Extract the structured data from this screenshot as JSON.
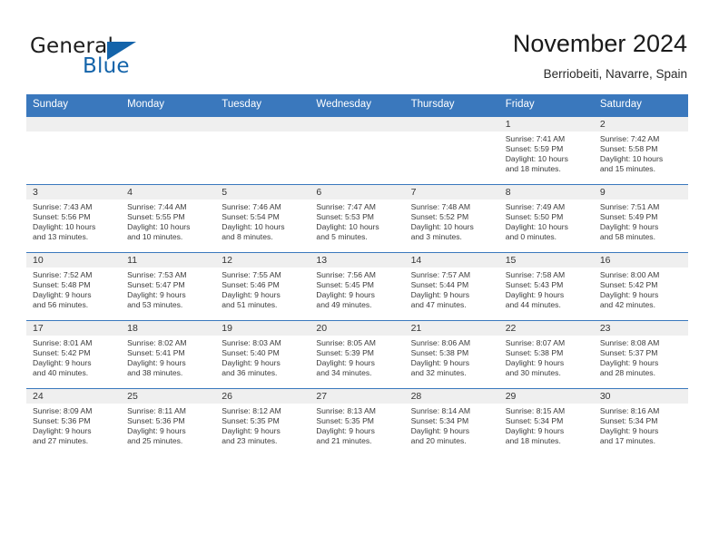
{
  "brand": {
    "word1": "General",
    "word2": "Blue",
    "accent_color": "#1464aa"
  },
  "header": {
    "title": "November 2024",
    "location": "Berriobeiti, Navarre, Spain"
  },
  "calendar": {
    "header_color": "#3a78bd",
    "weekdays": [
      "Sunday",
      "Monday",
      "Tuesday",
      "Wednesday",
      "Thursday",
      "Friday",
      "Saturday"
    ],
    "weeks": [
      [
        {
          "empty": true
        },
        {
          "empty": true
        },
        {
          "empty": true
        },
        {
          "empty": true
        },
        {
          "empty": true
        },
        {
          "day": "1",
          "sunrise": "Sunrise: 7:41 AM",
          "sunset": "Sunset: 5:59 PM",
          "daylight1": "Daylight: 10 hours",
          "daylight2": "and 18 minutes."
        },
        {
          "day": "2",
          "sunrise": "Sunrise: 7:42 AM",
          "sunset": "Sunset: 5:58 PM",
          "daylight1": "Daylight: 10 hours",
          "daylight2": "and 15 minutes."
        }
      ],
      [
        {
          "day": "3",
          "sunrise": "Sunrise: 7:43 AM",
          "sunset": "Sunset: 5:56 PM",
          "daylight1": "Daylight: 10 hours",
          "daylight2": "and 13 minutes."
        },
        {
          "day": "4",
          "sunrise": "Sunrise: 7:44 AM",
          "sunset": "Sunset: 5:55 PM",
          "daylight1": "Daylight: 10 hours",
          "daylight2": "and 10 minutes."
        },
        {
          "day": "5",
          "sunrise": "Sunrise: 7:46 AM",
          "sunset": "Sunset: 5:54 PM",
          "daylight1": "Daylight: 10 hours",
          "daylight2": "and 8 minutes."
        },
        {
          "day": "6",
          "sunrise": "Sunrise: 7:47 AM",
          "sunset": "Sunset: 5:53 PM",
          "daylight1": "Daylight: 10 hours",
          "daylight2": "and 5 minutes."
        },
        {
          "day": "7",
          "sunrise": "Sunrise: 7:48 AM",
          "sunset": "Sunset: 5:52 PM",
          "daylight1": "Daylight: 10 hours",
          "daylight2": "and 3 minutes."
        },
        {
          "day": "8",
          "sunrise": "Sunrise: 7:49 AM",
          "sunset": "Sunset: 5:50 PM",
          "daylight1": "Daylight: 10 hours",
          "daylight2": "and 0 minutes."
        },
        {
          "day": "9",
          "sunrise": "Sunrise: 7:51 AM",
          "sunset": "Sunset: 5:49 PM",
          "daylight1": "Daylight: 9 hours",
          "daylight2": "and 58 minutes."
        }
      ],
      [
        {
          "day": "10",
          "sunrise": "Sunrise: 7:52 AM",
          "sunset": "Sunset: 5:48 PM",
          "daylight1": "Daylight: 9 hours",
          "daylight2": "and 56 minutes."
        },
        {
          "day": "11",
          "sunrise": "Sunrise: 7:53 AM",
          "sunset": "Sunset: 5:47 PM",
          "daylight1": "Daylight: 9 hours",
          "daylight2": "and 53 minutes."
        },
        {
          "day": "12",
          "sunrise": "Sunrise: 7:55 AM",
          "sunset": "Sunset: 5:46 PM",
          "daylight1": "Daylight: 9 hours",
          "daylight2": "and 51 minutes."
        },
        {
          "day": "13",
          "sunrise": "Sunrise: 7:56 AM",
          "sunset": "Sunset: 5:45 PM",
          "daylight1": "Daylight: 9 hours",
          "daylight2": "and 49 minutes."
        },
        {
          "day": "14",
          "sunrise": "Sunrise: 7:57 AM",
          "sunset": "Sunset: 5:44 PM",
          "daylight1": "Daylight: 9 hours",
          "daylight2": "and 47 minutes."
        },
        {
          "day": "15",
          "sunrise": "Sunrise: 7:58 AM",
          "sunset": "Sunset: 5:43 PM",
          "daylight1": "Daylight: 9 hours",
          "daylight2": "and 44 minutes."
        },
        {
          "day": "16",
          "sunrise": "Sunrise: 8:00 AM",
          "sunset": "Sunset: 5:42 PM",
          "daylight1": "Daylight: 9 hours",
          "daylight2": "and 42 minutes."
        }
      ],
      [
        {
          "day": "17",
          "sunrise": "Sunrise: 8:01 AM",
          "sunset": "Sunset: 5:42 PM",
          "daylight1": "Daylight: 9 hours",
          "daylight2": "and 40 minutes."
        },
        {
          "day": "18",
          "sunrise": "Sunrise: 8:02 AM",
          "sunset": "Sunset: 5:41 PM",
          "daylight1": "Daylight: 9 hours",
          "daylight2": "and 38 minutes."
        },
        {
          "day": "19",
          "sunrise": "Sunrise: 8:03 AM",
          "sunset": "Sunset: 5:40 PM",
          "daylight1": "Daylight: 9 hours",
          "daylight2": "and 36 minutes."
        },
        {
          "day": "20",
          "sunrise": "Sunrise: 8:05 AM",
          "sunset": "Sunset: 5:39 PM",
          "daylight1": "Daylight: 9 hours",
          "daylight2": "and 34 minutes."
        },
        {
          "day": "21",
          "sunrise": "Sunrise: 8:06 AM",
          "sunset": "Sunset: 5:38 PM",
          "daylight1": "Daylight: 9 hours",
          "daylight2": "and 32 minutes."
        },
        {
          "day": "22",
          "sunrise": "Sunrise: 8:07 AM",
          "sunset": "Sunset: 5:38 PM",
          "daylight1": "Daylight: 9 hours",
          "daylight2": "and 30 minutes."
        },
        {
          "day": "23",
          "sunrise": "Sunrise: 8:08 AM",
          "sunset": "Sunset: 5:37 PM",
          "daylight1": "Daylight: 9 hours",
          "daylight2": "and 28 minutes."
        }
      ],
      [
        {
          "day": "24",
          "sunrise": "Sunrise: 8:09 AM",
          "sunset": "Sunset: 5:36 PM",
          "daylight1": "Daylight: 9 hours",
          "daylight2": "and 27 minutes."
        },
        {
          "day": "25",
          "sunrise": "Sunrise: 8:11 AM",
          "sunset": "Sunset: 5:36 PM",
          "daylight1": "Daylight: 9 hours",
          "daylight2": "and 25 minutes."
        },
        {
          "day": "26",
          "sunrise": "Sunrise: 8:12 AM",
          "sunset": "Sunset: 5:35 PM",
          "daylight1": "Daylight: 9 hours",
          "daylight2": "and 23 minutes."
        },
        {
          "day": "27",
          "sunrise": "Sunrise: 8:13 AM",
          "sunset": "Sunset: 5:35 PM",
          "daylight1": "Daylight: 9 hours",
          "daylight2": "and 21 minutes."
        },
        {
          "day": "28",
          "sunrise": "Sunrise: 8:14 AM",
          "sunset": "Sunset: 5:34 PM",
          "daylight1": "Daylight: 9 hours",
          "daylight2": "and 20 minutes."
        },
        {
          "day": "29",
          "sunrise": "Sunrise: 8:15 AM",
          "sunset": "Sunset: 5:34 PM",
          "daylight1": "Daylight: 9 hours",
          "daylight2": "and 18 minutes."
        },
        {
          "day": "30",
          "sunrise": "Sunrise: 8:16 AM",
          "sunset": "Sunset: 5:34 PM",
          "daylight1": "Daylight: 9 hours",
          "daylight2": "and 17 minutes."
        }
      ]
    ]
  }
}
